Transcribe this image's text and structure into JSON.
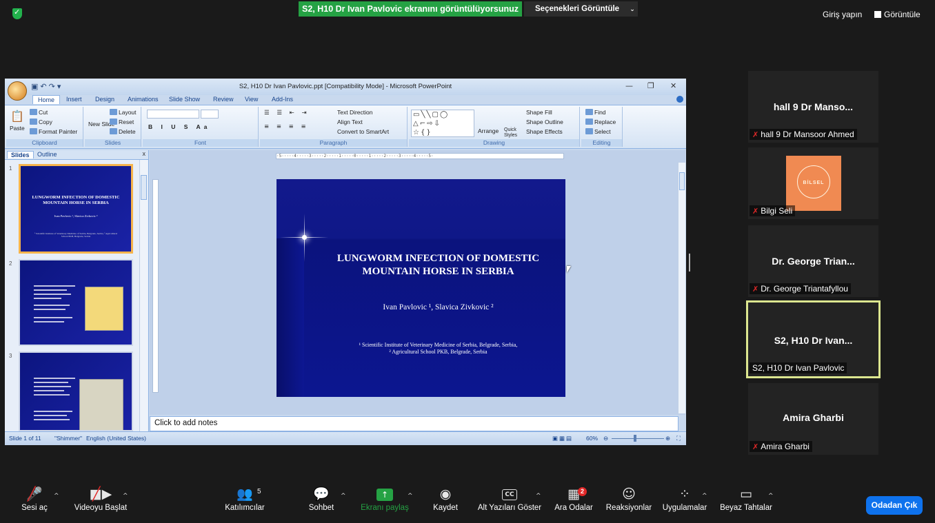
{
  "zoom": {
    "banner": "S2, H10 Dr Ivan Pavlovic ekranını görüntülüyorsunuz",
    "view_options": "Seçenekleri Görüntüle",
    "signin": "Giriş yapın",
    "gallery": "Görüntüle"
  },
  "ppt": {
    "window_title": "S2, H10 Dr Ivan Pavlovic.ppt [Compatibility Mode] - Microsoft PowerPoint",
    "tabs": [
      "Home",
      "Insert",
      "Design",
      "Animations",
      "Slide Show",
      "Review",
      "View",
      "Add-Ins"
    ],
    "ribbon": {
      "clipboard": {
        "label": "Clipboard",
        "paste": "Paste",
        "cut": "Cut",
        "copy": "Copy",
        "format_painter": "Format Painter"
      },
      "slides": {
        "label": "Slides",
        "new_slide": "New Slide",
        "layout": "Layout",
        "reset": "Reset",
        "delete": "Delete"
      },
      "font": {
        "label": "Font"
      },
      "paragraph": {
        "label": "Paragraph",
        "text_direction": "Text Direction",
        "align_text": "Align Text",
        "convert": "Convert to SmartArt"
      },
      "drawing": {
        "label": "Drawing",
        "arrange": "Arrange",
        "quick_styles": "Quick Styles",
        "shape_fill": "Shape Fill",
        "shape_outline": "Shape Outline",
        "shape_effects": "Shape Effects"
      },
      "editing": {
        "label": "Editing",
        "find": "Find",
        "replace": "Replace",
        "select": "Select"
      }
    },
    "pane_tabs": [
      "Slides",
      "Outline"
    ],
    "thumbnails": [
      {
        "num": "1",
        "title": "LUNGWORM INFECTION OF DOMESTIC MOUNTAIN HORSE IN SERBIA",
        "authors": "Ivan Pavlovic ¹, Slavica Zivkovic ²",
        "affil": "¹ Scientific Institute of Veterinary Medicine of Serbia, Belgrade, Serbia, ² Agricultural School PKB, Belgrade, Serbia"
      },
      {
        "num": "2"
      },
      {
        "num": "3"
      }
    ],
    "slide": {
      "title": "LUNGWORM INFECTION OF DOMESTIC MOUNTAIN HORSE IN SERBIA",
      "authors": "Ivan Pavlovic ¹, Slavica Zivkovic ²",
      "affil_1": "¹ Scientific Institute of Veterinary Medicine of Serbia, Belgrade, Serbia,",
      "affil_2": "² Agricultural School PKB, Belgrade, Serbia"
    },
    "notes_placeholder": "Click to add notes",
    "status": {
      "slide": "Slide 1 of 11",
      "theme": "\"Shimmer\"",
      "language": "English (United States)",
      "zoom": "60%"
    }
  },
  "participants": [
    {
      "tile_name": "hall 9 Dr Manso...",
      "label": "hall 9 Dr Mansoor Ahmed",
      "muted": true
    },
    {
      "tile_name": "",
      "label": "Bilgi Seli",
      "muted": true,
      "avatar_text": "BİLSEL"
    },
    {
      "tile_name": "Dr. George Trian...",
      "label": "Dr. George Triantafyllou",
      "muted": true
    },
    {
      "tile_name": "S2, H10 Dr Ivan...",
      "label": "S2, H10 Dr Ivan Pavlovic",
      "muted": false
    },
    {
      "tile_name": "Amira Gharbi",
      "label": "Amira Gharbi",
      "muted": true
    }
  ],
  "toolbar": {
    "unmute": "Sesi aç",
    "start_video": "Videoyu Başlat",
    "participants": "Katılımcılar",
    "participants_count": "5",
    "chat": "Sohbet",
    "share": "Ekranı paylaş",
    "record": "Kaydet",
    "captions": "Alt Yazıları Göster",
    "breakout": "Ara Odalar",
    "breakout_badge": "2",
    "reactions": "Reaksiyonlar",
    "apps": "Uygulamalar",
    "whiteboard": "Beyaz Tahtalar",
    "leave": "Odadan Çık"
  },
  "colors": {
    "share_green": "#25a244",
    "leave_blue": "#0e72ed",
    "slide_blue": "#0c1690",
    "active_speaker": "#dce68f"
  }
}
